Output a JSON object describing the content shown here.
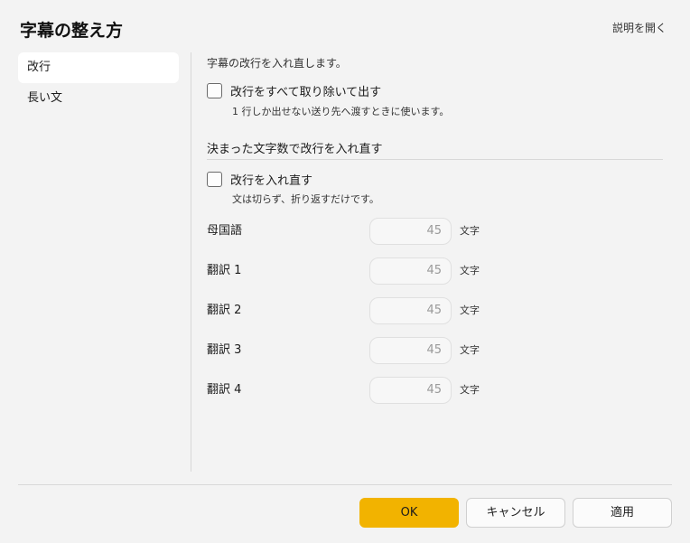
{
  "dialog": {
    "title": "字幕の整え方",
    "help_link": "説明を開く"
  },
  "sidebar": {
    "items": [
      {
        "label": "改行",
        "active": true
      },
      {
        "label": "長い文",
        "active": false
      }
    ]
  },
  "content": {
    "description": "字幕の改行を入れ直します。",
    "remove_breaks": {
      "label": "改行をすべて取り除いて出す",
      "hint": "1 行しか出せない送り先へ渡すときに使います。",
      "checked": false
    },
    "section_title": "決まった文字数で改行を入れ直す",
    "rewrap": {
      "label": "改行を入れ直す",
      "hint": "文は切らず、折り返すだけです。",
      "checked": false
    },
    "fields": [
      {
        "label": "母国語",
        "value": "45",
        "unit": "文字"
      },
      {
        "label": "翻訳 1",
        "value": "45",
        "unit": "文字"
      },
      {
        "label": "翻訳 2",
        "value": "45",
        "unit": "文字"
      },
      {
        "label": "翻訳 3",
        "value": "45",
        "unit": "文字"
      },
      {
        "label": "翻訳 4",
        "value": "45",
        "unit": "文字"
      }
    ]
  },
  "buttons": {
    "ok": "OK",
    "cancel": "キャンセル",
    "apply": "適用"
  },
  "colors": {
    "accent": "#f2b300",
    "background": "#f3f3f3"
  }
}
